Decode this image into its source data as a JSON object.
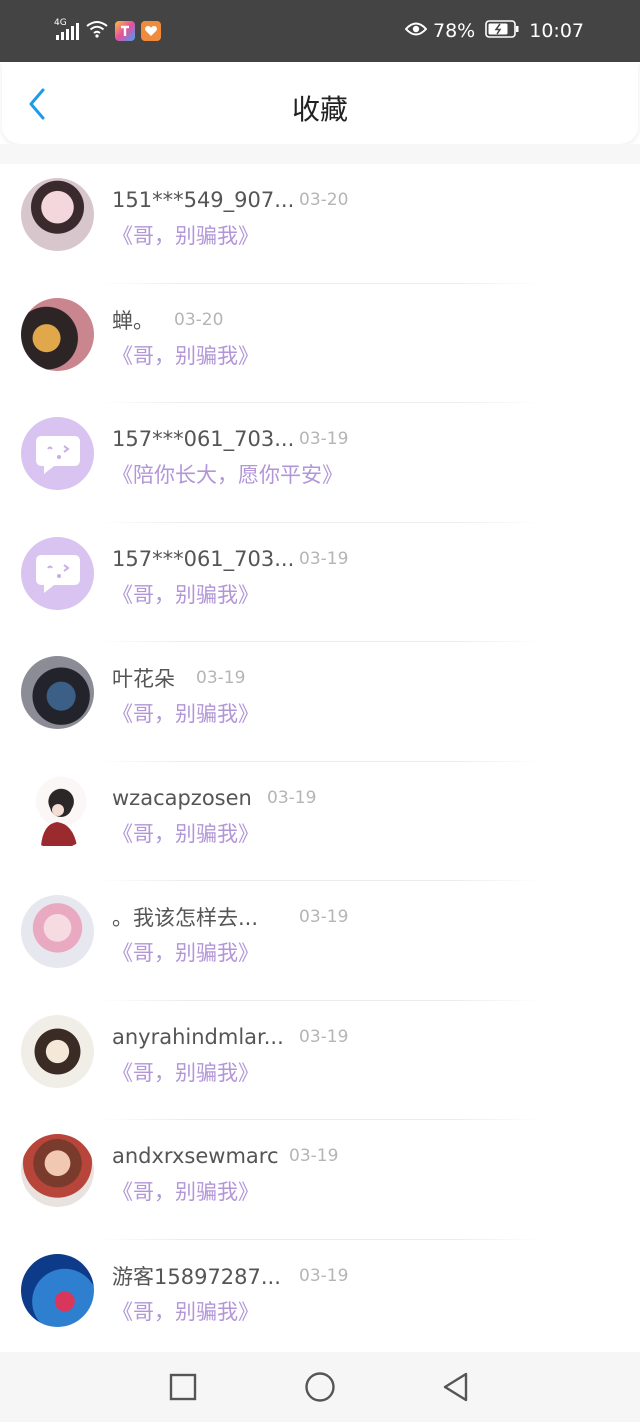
{
  "status_bar": {
    "network": "4G",
    "battery": "78%",
    "time": "10:07",
    "icons": [
      "signal-icon",
      "wifi-icon",
      "app-notification-icon",
      "app-notification-icon",
      "eye-icon",
      "battery-icon"
    ]
  },
  "header": {
    "title": "收藏",
    "back_icon": "chevron-left-icon"
  },
  "favorites": [
    {
      "name": "151***549_907...",
      "date": "03-20",
      "work": "《哥，别骗我》",
      "avatar": "photo"
    },
    {
      "name": "蝉。",
      "date": "03-20",
      "work": "《哥，别骗我》",
      "avatar": "photo"
    },
    {
      "name": "157***061_703...",
      "date": "03-19",
      "work": "《陪你长大，愿你平安》",
      "avatar": "default"
    },
    {
      "name": "157***061_703...",
      "date": "03-19",
      "work": "《哥，别骗我》",
      "avatar": "default"
    },
    {
      "name": "叶花朵",
      "date": "03-19",
      "work": "《哥，别骗我》",
      "avatar": "photo"
    },
    {
      "name": "wzacapzosen",
      "date": "03-19",
      "work": "《哥，别骗我》",
      "avatar": "photo"
    },
    {
      "name": "。我该怎样去...",
      "date": "03-19",
      "work": "《哥，别骗我》",
      "avatar": "photo"
    },
    {
      "name": "anyrahindmlar...",
      "date": "03-19",
      "work": "《哥，别骗我》",
      "avatar": "photo"
    },
    {
      "name": "andxrxsewmarc",
      "date": "03-19",
      "work": "《哥，别骗我》",
      "avatar": "photo"
    },
    {
      "name": "游客15897287...",
      "date": "03-19",
      "work": "《哥，别骗我》",
      "avatar": "photo"
    }
  ],
  "nav_bar": {
    "icons": [
      "recent-apps-icon",
      "home-icon",
      "back-icon"
    ]
  },
  "colors": {
    "status_bar_bg": "#444444",
    "accent_blue": "#1e9be8",
    "work_title": "#b296d8",
    "default_avatar": "#d9c4f1"
  }
}
